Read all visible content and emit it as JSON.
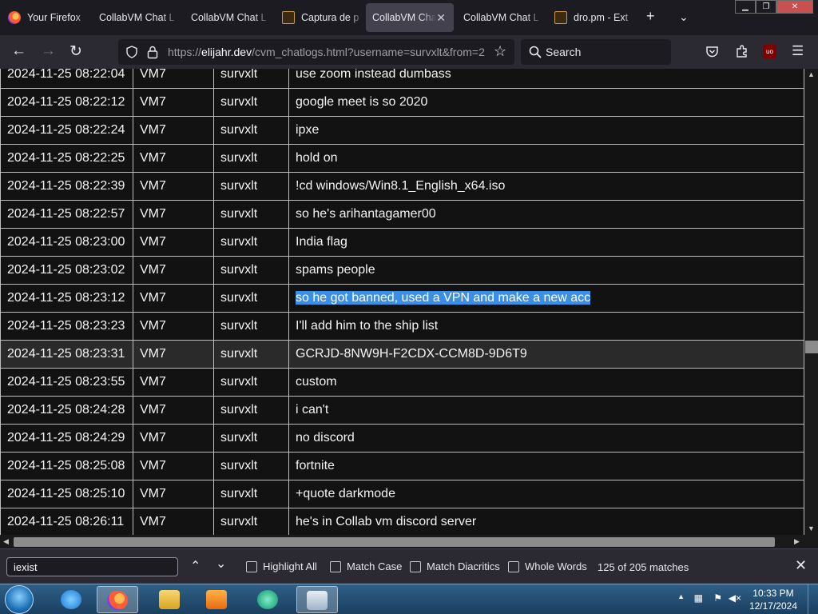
{
  "browser": {
    "tabs": [
      {
        "label": "Your Firefox",
        "favicon": "firefox-icon",
        "active": false
      },
      {
        "label": "CollabVM Chat L",
        "favicon": "",
        "active": false
      },
      {
        "label": "CollabVM Chat L",
        "favicon": "",
        "active": false
      },
      {
        "label": "Captura de p",
        "favicon": "image-icon",
        "active": false
      },
      {
        "label": "CollabVM Chat",
        "favicon": "",
        "active": true
      },
      {
        "label": "CollabVM Chat L",
        "favicon": "",
        "active": false
      },
      {
        "label": "dro.pm - Ext",
        "favicon": "image-icon",
        "active": false
      }
    ],
    "new_tab_label": "+",
    "url_prefix": "https://",
    "url_host": "elijahr.dev",
    "url_path": "/cvm_chatlogs.html?username=survxlt&from=2",
    "search_placeholder": "Search",
    "extension_badge": "uo"
  },
  "log": {
    "rows": [
      {
        "time": "2024-11-25 08:22:04",
        "vm": "VM7",
        "user": "survxlt",
        "msg": "use zoom instead dumbass"
      },
      {
        "time": "2024-11-25 08:22:12",
        "vm": "VM7",
        "user": "survxlt",
        "msg": "google meet is so 2020"
      },
      {
        "time": "2024-11-25 08:22:24",
        "vm": "VM7",
        "user": "survxlt",
        "msg": "ipxe"
      },
      {
        "time": "2024-11-25 08:22:25",
        "vm": "VM7",
        "user": "survxlt",
        "msg": "hold on"
      },
      {
        "time": "2024-11-25 08:22:39",
        "vm": "VM7",
        "user": "survxlt",
        "msg": "!cd windows/Win8.1_English_x64.iso"
      },
      {
        "time": "2024-11-25 08:22:57",
        "vm": "VM7",
        "user": "survxlt",
        "msg": "so he's arihantagamer00"
      },
      {
        "time": "2024-11-25 08:23:00",
        "vm": "VM7",
        "user": "survxlt",
        "msg": "India flag"
      },
      {
        "time": "2024-11-25 08:23:02",
        "vm": "VM7",
        "user": "survxlt",
        "msg": "spams people"
      },
      {
        "time": "2024-11-25 08:23:12",
        "vm": "VM7",
        "user": "survxlt",
        "msg": "so he got banned, used a VPN and make a new acc",
        "selected": true
      },
      {
        "time": "2024-11-25 08:23:23",
        "vm": "VM7",
        "user": "survxlt",
        "msg": "I'll add him to the ship list"
      },
      {
        "time": "2024-11-25 08:23:31",
        "vm": "VM7",
        "user": "survxlt",
        "msg": "GCRJD-8NW9H-F2CDX-CCM8D-9D6T9",
        "hover": true
      },
      {
        "time": "2024-11-25 08:23:55",
        "vm": "VM7",
        "user": "survxlt",
        "msg": "custom"
      },
      {
        "time": "2024-11-25 08:24:28",
        "vm": "VM7",
        "user": "survxlt",
        "msg": "i can't"
      },
      {
        "time": "2024-11-25 08:24:29",
        "vm": "VM7",
        "user": "survxlt",
        "msg": "no discord"
      },
      {
        "time": "2024-11-25 08:25:08",
        "vm": "VM7",
        "user": "survxlt",
        "msg": "fortnite"
      },
      {
        "time": "2024-11-25 08:25:10",
        "vm": "VM7",
        "user": "survxlt",
        "msg": "+quote darkmode"
      },
      {
        "time": "2024-11-25 08:26:11",
        "vm": "VM7",
        "user": "survxlt",
        "msg": "he's in Collab vm discord server"
      }
    ]
  },
  "findbar": {
    "query": "iexist",
    "highlight_all": "Highlight All",
    "match_case": "Match Case",
    "match_diacritics": "Match Diacritics",
    "whole_words": "Whole Words",
    "count": "125 of 205 matches"
  },
  "taskbar": {
    "time": "10:33 PM",
    "date": "12/17/2024"
  },
  "colors": {
    "selection": "#3a8ee6",
    "page_background": "#121212",
    "toolbar": "#2b2a33"
  }
}
